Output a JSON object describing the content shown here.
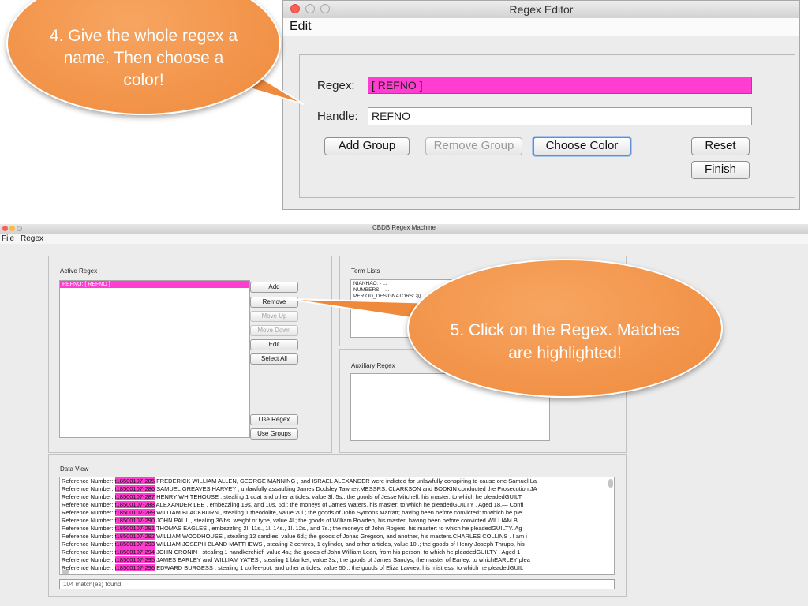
{
  "callouts": {
    "step4": "4. Give the whole regex a name. Then choose a color!",
    "step5": "5. Click on the Regex. Matches are highlighted!"
  },
  "editor": {
    "title": "Regex Editor",
    "menu": [
      "Edit"
    ],
    "regex_label": "Regex:",
    "regex_value": "[ REFNO ]",
    "regex_highlight_color": "#ff3dd0",
    "handle_label": "Handle:",
    "handle_value": "REFNO",
    "buttons": {
      "add_group": "Add Group",
      "remove_group": "Remove Group",
      "choose_color": "Choose Color",
      "reset": "Reset",
      "finish": "Finish"
    }
  },
  "main": {
    "title": "CBDB Regex Machine",
    "menu": [
      "File",
      "Regex"
    ],
    "active_regex": {
      "label": "Active Regex",
      "items": [
        "REFNO: [ REFNO ]"
      ]
    },
    "buttons": {
      "add": "Add",
      "remove": "Remove",
      "move_up": "Move Up",
      "move_down": "Move Down",
      "edit": "Edit",
      "select_all": "Select All",
      "use_regex": "Use Regex",
      "use_groups": "Use Groups"
    },
    "term_lists": {
      "label": "Term Lists",
      "items": [
        "NIANHAO: · ...",
        "NUMBERS: · ...",
        "PERIOD_DESIGNATORS: 初"
      ]
    },
    "auxiliary_regex": {
      "label": "Auxiliary Regex"
    },
    "data_view": {
      "label": "Data View",
      "prefix": "Reference Number: ",
      "rows": [
        {
          "ref": "t18500107-285",
          "text": "FREDERICK WILLIAM ALLEN, GEORGE MANNING , and ISRAEL ALEXANDER were indicted for unlawfully conspiring to cause one Samuel La"
        },
        {
          "ref": "t18500107-286",
          "text": "SAMUEL GREAVES HARVEY , unlawfully assaulting James Dodsley Tawney.MESSRS. CLARKSON and BODKIN conducted the Prosecution.JA"
        },
        {
          "ref": "t18500107-287",
          "text": "HENRY WHITEHOUSE , stealing 1 coat and other articles, value 3l. 5s.; the goods of Jesse Mitchell, his master: to which he pleadedGUILT"
        },
        {
          "ref": "t18500107-288",
          "text": "ALEXANDER LEE , embezzling 19s. and 10s. 5d.; the moneys of James Waters, his master: to which he pleadedGUILTY . Aged 18.— Confi"
        },
        {
          "ref": "t18500107-289",
          "text": "WILLIAM BLACKBURN , stealing 1 theodolite, value 20l.; the goods of John Symons Marratt; having been before convicted: to which he ple"
        },
        {
          "ref": "t18500107-290",
          "text": "JOHN PAUL , stealing 36lbs. weight of type, value 4l.; the goods of William Bowden, his master: having been before convicted.WILLIAM B"
        },
        {
          "ref": "t18500107-291",
          "text": "THOMAS EAGLES , embezzling 2l. 11s., 1l. 14s., 1l. 12s., and 7s.; the moneys of John Rogers, his master: to which he pleadedGUILTY. Ag"
        },
        {
          "ref": "t18500107-292",
          "text": "WILLIAM WOODHOUSE , stealing 12 candles, value 6d.; the goods of Jonas Gregson, and another, his masters.CHARLES COLLINS . I am i"
        },
        {
          "ref": "t18500107-293",
          "text": "WILLIAM JOSEPH BLAND MATTHEWS , stealing 2 centres, 1 cylinder, and other articles, value 10l.; the goods of Henry Joseph Thrupp, his"
        },
        {
          "ref": "t18500107-294",
          "text": "JOHN CRONIN , stealing 1 handkerchief, value 4s.; the goods of John William Lean, from his person: to which he pleadedGUILTY . Aged 1"
        },
        {
          "ref": "t18500107-295",
          "text": "JAMES EARLEY and WILLIAM YATES , stealing 1 blanket, value 3s.; the goods of James Sandys, the master of Earley: to whichEARLEY plea"
        },
        {
          "ref": "t18500107-296",
          "text": "EDWARD BURGESS , stealing 1 coffee-pot, and other articles, value 50l.; the goods of Eliza Lawrey, his mistress: to which he pleadedGUIL"
        }
      ]
    },
    "status": "104 match(es) found."
  },
  "colors": {
    "highlight": "#ff3dd0",
    "callout_orange": "#f0903f",
    "focus_blue": "#5d8fd6"
  }
}
